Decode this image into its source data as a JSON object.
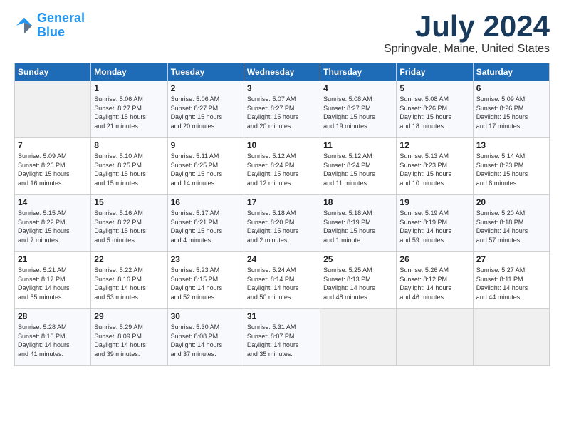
{
  "logo": {
    "line1": "General",
    "line2": "Blue"
  },
  "title": "July 2024",
  "location": "Springvale, Maine, United States",
  "days_header": [
    "Sunday",
    "Monday",
    "Tuesday",
    "Wednesday",
    "Thursday",
    "Friday",
    "Saturday"
  ],
  "weeks": [
    [
      {
        "day": "",
        "info": ""
      },
      {
        "day": "1",
        "info": "Sunrise: 5:06 AM\nSunset: 8:27 PM\nDaylight: 15 hours\nand 21 minutes."
      },
      {
        "day": "2",
        "info": "Sunrise: 5:06 AM\nSunset: 8:27 PM\nDaylight: 15 hours\nand 20 minutes."
      },
      {
        "day": "3",
        "info": "Sunrise: 5:07 AM\nSunset: 8:27 PM\nDaylight: 15 hours\nand 20 minutes."
      },
      {
        "day": "4",
        "info": "Sunrise: 5:08 AM\nSunset: 8:27 PM\nDaylight: 15 hours\nand 19 minutes."
      },
      {
        "day": "5",
        "info": "Sunrise: 5:08 AM\nSunset: 8:26 PM\nDaylight: 15 hours\nand 18 minutes."
      },
      {
        "day": "6",
        "info": "Sunrise: 5:09 AM\nSunset: 8:26 PM\nDaylight: 15 hours\nand 17 minutes."
      }
    ],
    [
      {
        "day": "7",
        "info": "Sunrise: 5:09 AM\nSunset: 8:26 PM\nDaylight: 15 hours\nand 16 minutes."
      },
      {
        "day": "8",
        "info": "Sunrise: 5:10 AM\nSunset: 8:25 PM\nDaylight: 15 hours\nand 15 minutes."
      },
      {
        "day": "9",
        "info": "Sunrise: 5:11 AM\nSunset: 8:25 PM\nDaylight: 15 hours\nand 14 minutes."
      },
      {
        "day": "10",
        "info": "Sunrise: 5:12 AM\nSunset: 8:24 PM\nDaylight: 15 hours\nand 12 minutes."
      },
      {
        "day": "11",
        "info": "Sunrise: 5:12 AM\nSunset: 8:24 PM\nDaylight: 15 hours\nand 11 minutes."
      },
      {
        "day": "12",
        "info": "Sunrise: 5:13 AM\nSunset: 8:23 PM\nDaylight: 15 hours\nand 10 minutes."
      },
      {
        "day": "13",
        "info": "Sunrise: 5:14 AM\nSunset: 8:23 PM\nDaylight: 15 hours\nand 8 minutes."
      }
    ],
    [
      {
        "day": "14",
        "info": "Sunrise: 5:15 AM\nSunset: 8:22 PM\nDaylight: 15 hours\nand 7 minutes."
      },
      {
        "day": "15",
        "info": "Sunrise: 5:16 AM\nSunset: 8:22 PM\nDaylight: 15 hours\nand 5 minutes."
      },
      {
        "day": "16",
        "info": "Sunrise: 5:17 AM\nSunset: 8:21 PM\nDaylight: 15 hours\nand 4 minutes."
      },
      {
        "day": "17",
        "info": "Sunrise: 5:18 AM\nSunset: 8:20 PM\nDaylight: 15 hours\nand 2 minutes."
      },
      {
        "day": "18",
        "info": "Sunrise: 5:18 AM\nSunset: 8:19 PM\nDaylight: 15 hours\nand 1 minute."
      },
      {
        "day": "19",
        "info": "Sunrise: 5:19 AM\nSunset: 8:19 PM\nDaylight: 14 hours\nand 59 minutes."
      },
      {
        "day": "20",
        "info": "Sunrise: 5:20 AM\nSunset: 8:18 PM\nDaylight: 14 hours\nand 57 minutes."
      }
    ],
    [
      {
        "day": "21",
        "info": "Sunrise: 5:21 AM\nSunset: 8:17 PM\nDaylight: 14 hours\nand 55 minutes."
      },
      {
        "day": "22",
        "info": "Sunrise: 5:22 AM\nSunset: 8:16 PM\nDaylight: 14 hours\nand 53 minutes."
      },
      {
        "day": "23",
        "info": "Sunrise: 5:23 AM\nSunset: 8:15 PM\nDaylight: 14 hours\nand 52 minutes."
      },
      {
        "day": "24",
        "info": "Sunrise: 5:24 AM\nSunset: 8:14 PM\nDaylight: 14 hours\nand 50 minutes."
      },
      {
        "day": "25",
        "info": "Sunrise: 5:25 AM\nSunset: 8:13 PM\nDaylight: 14 hours\nand 48 minutes."
      },
      {
        "day": "26",
        "info": "Sunrise: 5:26 AM\nSunset: 8:12 PM\nDaylight: 14 hours\nand 46 minutes."
      },
      {
        "day": "27",
        "info": "Sunrise: 5:27 AM\nSunset: 8:11 PM\nDaylight: 14 hours\nand 44 minutes."
      }
    ],
    [
      {
        "day": "28",
        "info": "Sunrise: 5:28 AM\nSunset: 8:10 PM\nDaylight: 14 hours\nand 41 minutes."
      },
      {
        "day": "29",
        "info": "Sunrise: 5:29 AM\nSunset: 8:09 PM\nDaylight: 14 hours\nand 39 minutes."
      },
      {
        "day": "30",
        "info": "Sunrise: 5:30 AM\nSunset: 8:08 PM\nDaylight: 14 hours\nand 37 minutes."
      },
      {
        "day": "31",
        "info": "Sunrise: 5:31 AM\nSunset: 8:07 PM\nDaylight: 14 hours\nand 35 minutes."
      },
      {
        "day": "",
        "info": ""
      },
      {
        "day": "",
        "info": ""
      },
      {
        "day": "",
        "info": ""
      }
    ]
  ]
}
